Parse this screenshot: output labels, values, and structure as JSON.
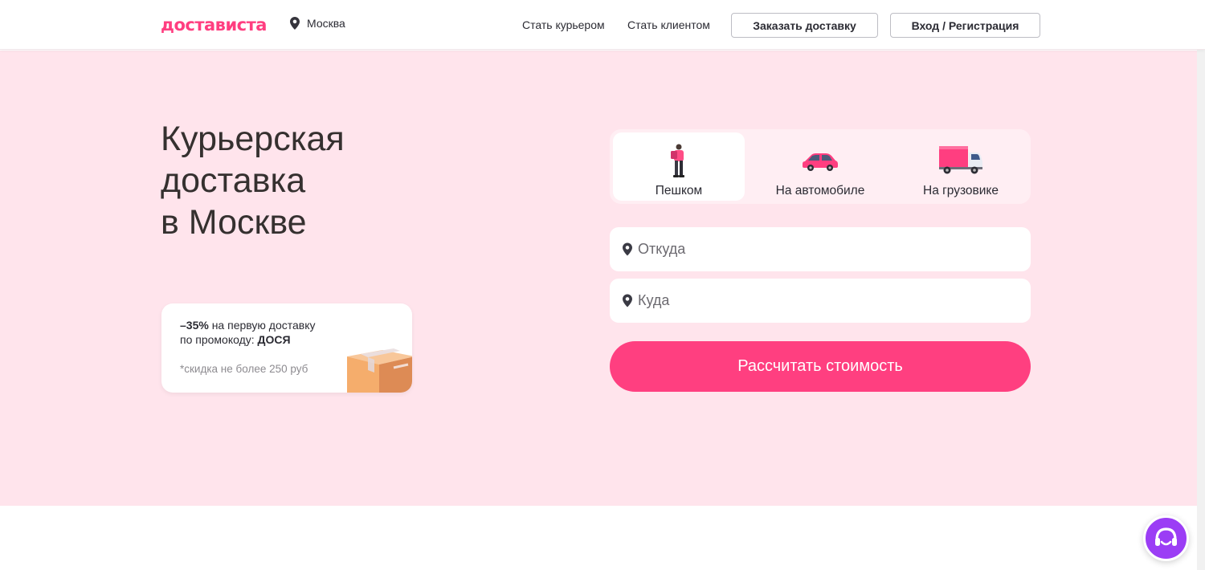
{
  "header": {
    "logo": "достависта",
    "city": "Москва",
    "nav": {
      "become_courier": "Стать курьером",
      "become_client": "Стать клиентом"
    },
    "order_button": "Заказать доставку",
    "login_button": "Вход / Регистрация"
  },
  "hero": {
    "title_lines": [
      "Курьерская",
      "доставка",
      "в Москве"
    ]
  },
  "promo": {
    "discount": "–35%",
    "line1_rest": " на первую доставку",
    "line2_prefix": "по промокоду: ",
    "code": "ДОСЯ",
    "note": "*скидка не более 250 руб"
  },
  "tabs": [
    {
      "label": "Пешком",
      "icon": "walking-courier-icon",
      "active": true
    },
    {
      "label": "На автомобиле",
      "icon": "car-icon",
      "active": false
    },
    {
      "label": "На грузовике",
      "icon": "truck-icon",
      "active": false
    }
  ],
  "form": {
    "from_placeholder": "Откуда",
    "to_placeholder": "Куда",
    "submit_label": "Рассчитать стоимость"
  },
  "colors": {
    "brand": "#ff3e80",
    "hero_bg": "#ffe4ec",
    "chat": "#9b3df5"
  },
  "icons": {
    "location": "map-pin-icon",
    "promo_image": "parcel-box-icon",
    "support": "support-chat-icon"
  }
}
